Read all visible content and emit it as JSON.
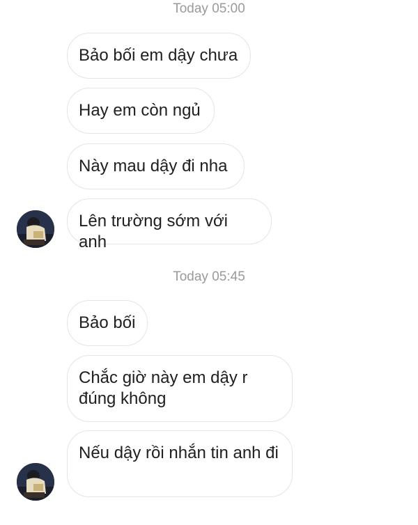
{
  "chat": {
    "groups": [
      {
        "timestamp": "Today 05:00",
        "messages": [
          "Bảo bối em dậy chưa",
          "Hay em còn ngủ",
          "Này mau dậy đi nha",
          "Lên trường sớm với anh"
        ]
      },
      {
        "timestamp": "Today 05:45",
        "messages": [
          "Bảo bối",
          "Chắc giờ này em dậy r đúng không",
          "Nếu dậy rồi nhắn tin anh đi"
        ]
      }
    ]
  },
  "icons": {
    "avatar": "profile-photo-icon"
  }
}
